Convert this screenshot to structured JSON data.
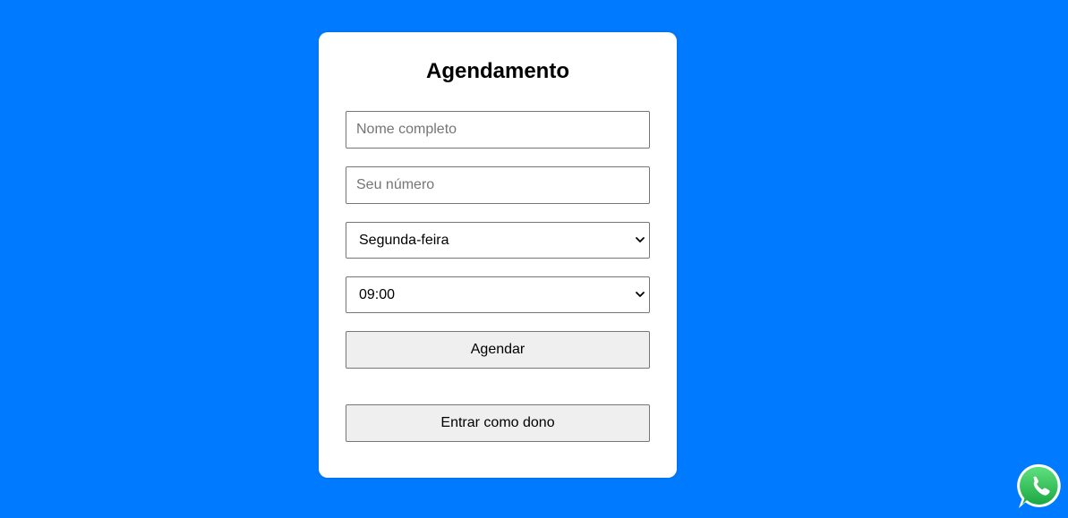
{
  "form": {
    "title": "Agendamento",
    "name_placeholder": "Nome completo",
    "phone_placeholder": "Seu número",
    "day_select": {
      "selected": "Segunda-feira"
    },
    "time_select": {
      "selected": "09:00"
    },
    "schedule_button_label": "Agendar",
    "owner_login_button_label": "Entrar como dono"
  },
  "colors": {
    "background": "#007bff",
    "card": "#ffffff",
    "button": "#efefef",
    "whatsapp_green": "#25d366"
  },
  "floating": {
    "icon": "whatsapp-icon"
  }
}
